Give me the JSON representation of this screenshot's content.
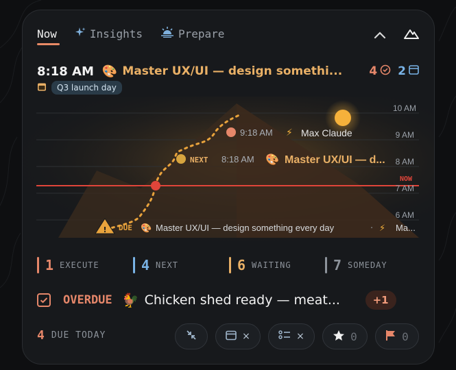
{
  "tabs": [
    {
      "label": "Now",
      "icon": "none"
    },
    {
      "label": "Insights",
      "icon": "sparkle-icon"
    },
    {
      "label": "Prepare",
      "icon": "sunrise-icon"
    }
  ],
  "header_icons": [
    "chevron-up-icon",
    "mountain-icon"
  ],
  "current": {
    "time": "8:18 AM",
    "emoji": "🎨",
    "title": "Master UX/UI — design somethi...",
    "count_done": "4",
    "count_calendar": "2",
    "tag": "Q3 launch day"
  },
  "timeline": {
    "hour_labels": [
      "10 AM",
      "9 AM",
      "8 AM",
      "7 AM",
      "6 AM"
    ],
    "now_label": "NOW",
    "next_up": {
      "time": "9:18 AM",
      "bolt": "⚡",
      "title": "Max Claude"
    },
    "next": {
      "badge": "NEXT",
      "time": "8:18 AM",
      "emoji": "🎨",
      "title": "Master UX/UI — d..."
    },
    "due": {
      "badge": "DUE",
      "emoji": "🎨",
      "title": "Master UX/UI — design something every day",
      "sep": "·",
      "bolt": "⚡",
      "more": "Ma..."
    }
  },
  "buckets": [
    {
      "count": "1",
      "label": "EXECUTE",
      "color": "#e6876a"
    },
    {
      "count": "4",
      "label": "NEXT",
      "color": "#79b3e6"
    },
    {
      "count": "6",
      "label": "WAITING",
      "color": "#e9b066"
    },
    {
      "count": "7",
      "label": "SOMEDAY",
      "color": "#8d939b"
    }
  ],
  "overdue": {
    "label": "OVERDUE",
    "emoji": "🐓",
    "title": "Chicken shed ready — meat...",
    "more": "+1"
  },
  "due_today": {
    "count": "4",
    "label": "DUE TODAY"
  },
  "filters": {
    "calendar_x": "×",
    "checklist_x": "×",
    "star_count": "0",
    "flag_count": "0"
  },
  "colors": {
    "accent": "#e6876a",
    "amber": "#e9b066",
    "blue": "#79b3e6",
    "now_line": "#e0453a"
  }
}
